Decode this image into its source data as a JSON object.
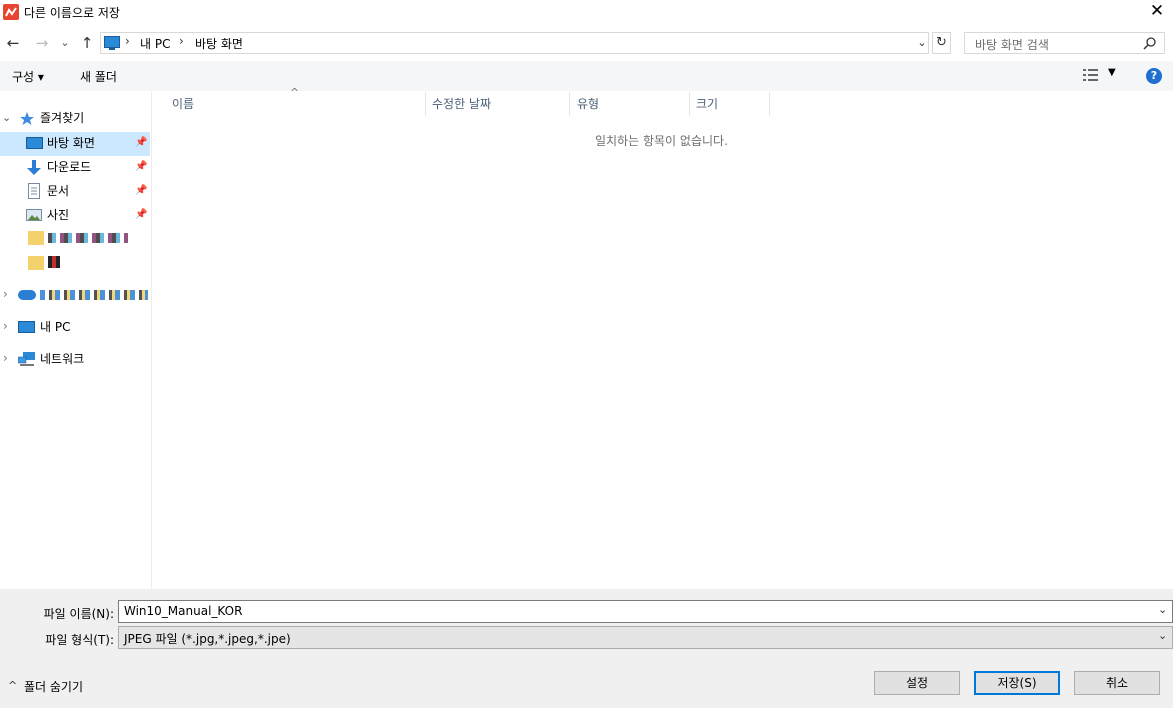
{
  "window": {
    "title": "다른 이름으로 저장",
    "close_glyph": "✕"
  },
  "address": {
    "back_glyph": "←",
    "forward_glyph": "→",
    "recent_glyph": "⌄",
    "up_glyph": "↑",
    "sep": "›",
    "crumbs": [
      "내 PC",
      "바탕 화면"
    ],
    "dropdown_glyph": "⌄",
    "refresh_glyph": "↻",
    "search_placeholder": "바탕 화면 검색"
  },
  "toolbar": {
    "organize_label": "구성 ▾",
    "new_folder_label": "새 폴더",
    "view_dd_glyph": "▼",
    "help_glyph": "?"
  },
  "nav": {
    "quick_access": "즐겨찾기",
    "items": [
      {
        "label": "바탕 화면",
        "icon": "desktop-icon"
      },
      {
        "label": "다운로드",
        "icon": "download-icon"
      },
      {
        "label": "문서",
        "icon": "document-icon"
      },
      {
        "label": "사진",
        "icon": "pictures-icon"
      }
    ],
    "pin_glyph": "📌",
    "expand_glyph": "›",
    "collapse_glyph": "⌄",
    "this_pc": "내 PC",
    "network": "네트워크"
  },
  "columns": [
    "이름",
    "수정한 날짜",
    "유형",
    "크기"
  ],
  "sort_glyph": "^",
  "empty_message": "일치하는 항목이 없습니다.",
  "bottom": {
    "filename_label": "파일 이름(N):",
    "filename_value": "Win10_Manual_KOR",
    "filetype_label": "파일 형식(T):",
    "filetype_value": "JPEG 파일 (*.jpg,*.jpeg,*.jpe)",
    "hide_folders": "폴더 숨기기",
    "hide_glyph": "^",
    "settings_button": "설정",
    "save_button": "저장(S)",
    "cancel_button": "취소"
  },
  "colors": {
    "accent": "#0078d7",
    "selection": "#cce8ff",
    "app_icon": "#e8442f",
    "help": "#1e6fd0"
  }
}
